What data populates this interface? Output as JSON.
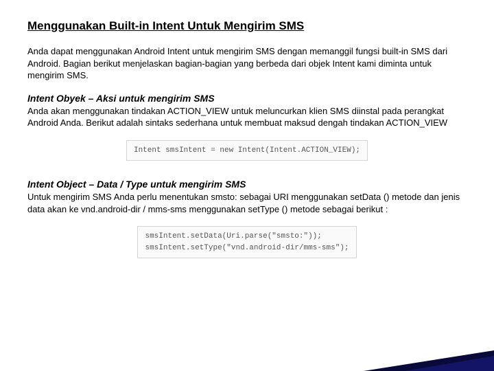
{
  "title": "Menggunakan Built-in Intent Untuk Mengirim SMS",
  "intro": "Anda dapat menggunakan Android Intent untuk mengirim SMS dengan memanggil fungsi built-in SMS dari Android. Bagian berikut menjelaskan bagian-bagian yang berbeda dari objek Intent kami diminta untuk mengirim SMS.",
  "section1": {
    "heading": "Intent Obyek – Aksi untuk mengirim SMS",
    "body": "Anda akan menggunakan tindakan ACTION_VIEW untuk meluncurkan klien SMS diinstal pada perangkat Android Anda. Berikut adalah sintaks sederhana untuk membuat maksud dengah tindakan ACTION_VIEW",
    "code": "Intent smsIntent = new Intent(Intent.ACTION_VIEW);"
  },
  "section2": {
    "heading": "Intent Object – Data / Type untuk mengirim SMS",
    "body": "Untuk mengirim SMS Anda perlu menentukan smsto: sebagai URI menggunakan setData () metode dan jenis data akan ke vnd.android-dir / mms-sms menggunakan setType () metode sebagai berikut :",
    "code": "smsIntent.setData(Uri.parse(\"smsto:\"));\nsmsIntent.setType(\"vnd.android-dir/mms-sms\");"
  }
}
